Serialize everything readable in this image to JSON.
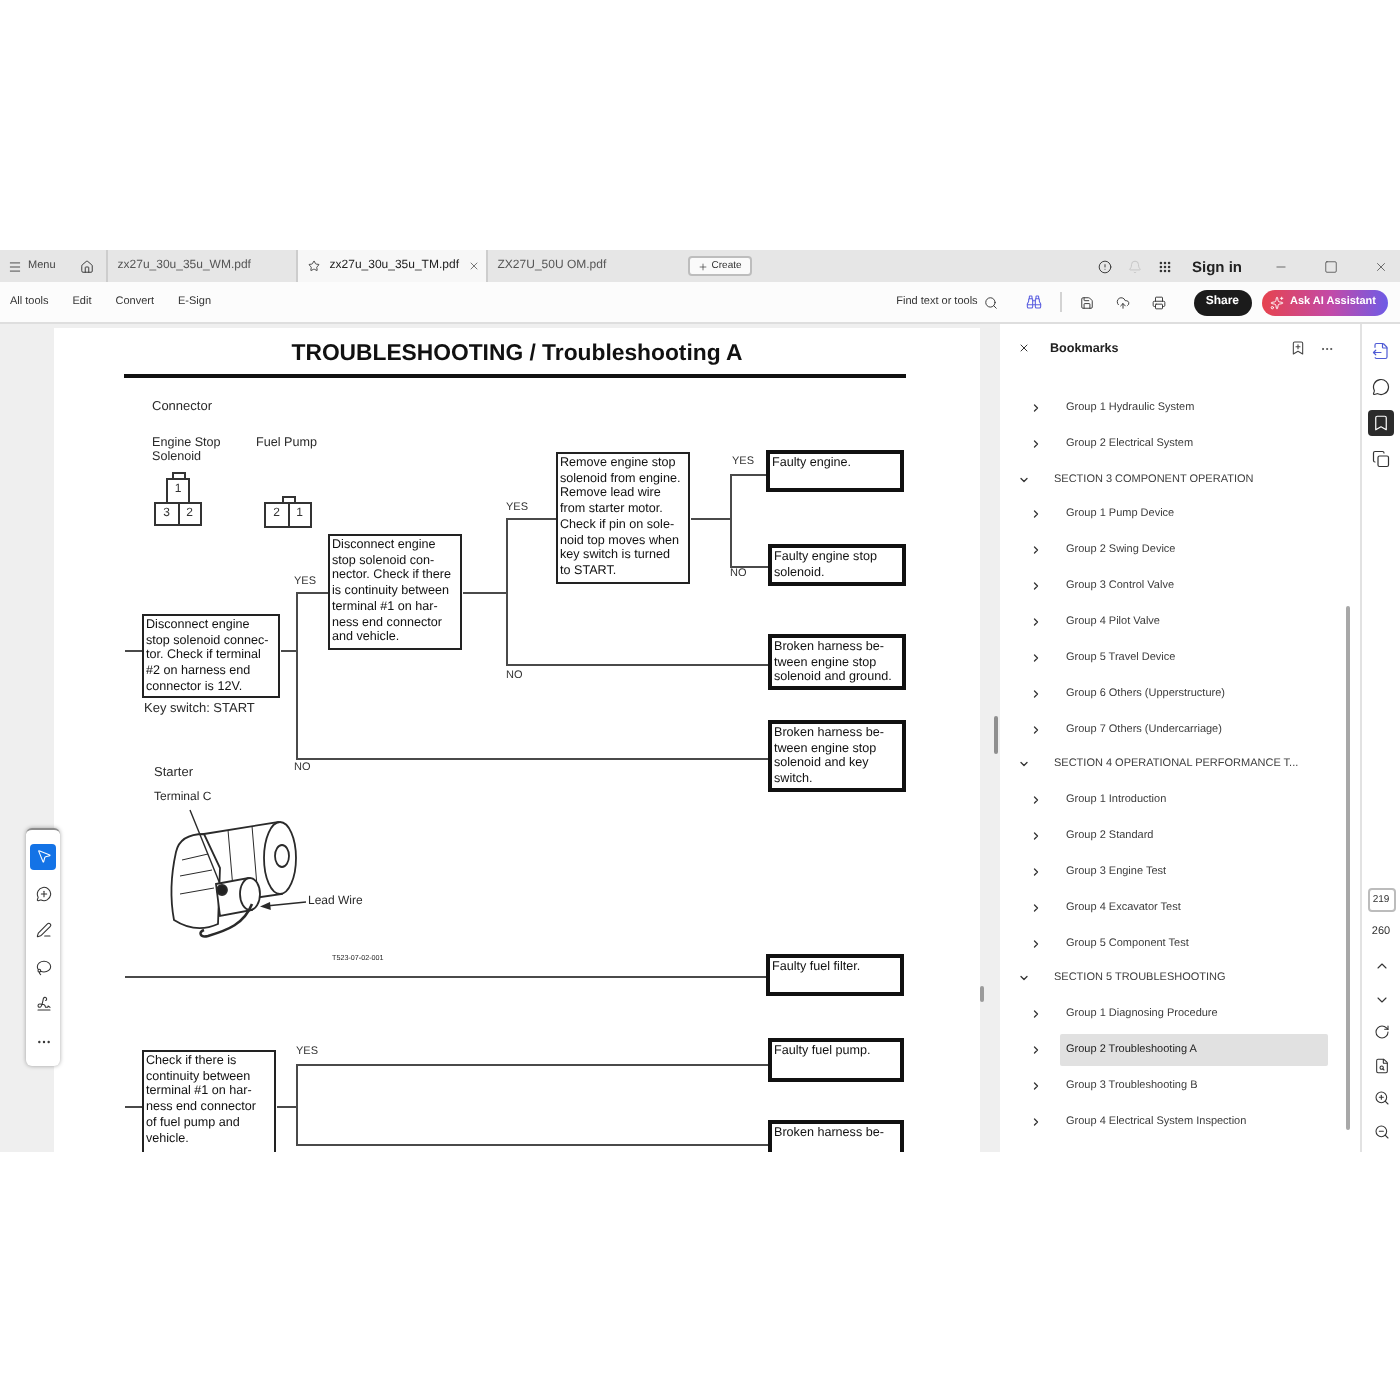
{
  "window": {
    "menu_label": "Menu",
    "tabs": [
      {
        "title": "zx27u_30u_35u_WM.pdf",
        "selected": false
      },
      {
        "title": "zx27u_30u_35u_TM.pdf",
        "selected": true
      },
      {
        "title": "ZX27U_50U OM.pdf",
        "selected": false
      }
    ],
    "create_label": "Create",
    "sign_in_label": "Sign in"
  },
  "toolbar": {
    "items": [
      "All tools",
      "Edit",
      "Convert",
      "E-Sign"
    ],
    "search_label": "Find text or tools",
    "share_label": "Share",
    "assistant_label": "Ask AI Assistant"
  },
  "tool_palette": [
    {
      "kind": "select",
      "selected": true
    },
    {
      "kind": "comment",
      "selected": false
    },
    {
      "kind": "draw",
      "selected": false
    },
    {
      "kind": "shape",
      "selected": false
    },
    {
      "kind": "sign",
      "selected": false
    },
    {
      "kind": "more",
      "selected": false
    }
  ],
  "document": {
    "title": "TROUBLESHOOTING / Troubleshooting A",
    "connector_heading": "Connector",
    "connectors": [
      {
        "label_lines": [
          "Engine Stop",
          "Solenoid"
        ],
        "pin_rows": [
          [
            "1"
          ],
          [
            "3",
            "2"
          ]
        ]
      },
      {
        "label_lines": [
          "Fuel Pump"
        ],
        "pin_rows": [
          [
            "2",
            "1"
          ]
        ]
      }
    ],
    "key_note": "Key switch: START",
    "starter_caption": "Starter",
    "terminal_label": "Terminal C",
    "lead_wire_label": "Lead Wire",
    "figure_code": "T523-07-02-001",
    "steps": [
      {
        "kind": "check",
        "lines": [
          "Disconnect engine",
          "stop solenoid connec-",
          "tor. Check if terminal",
          "#2 on harness end",
          "connector is 12V."
        ]
      },
      {
        "kind": "check",
        "lines": [
          "Disconnect engine",
          "stop solenoid con-",
          "nector. Check if there",
          "is continuity between",
          "terminal #1 on har-",
          "ness end connector",
          "and vehicle."
        ]
      },
      {
        "kind": "check",
        "lines": [
          "Remove engine stop",
          "solenoid from engine.",
          "Remove lead wire",
          "from starter motor.",
          "Check if pin on sole-",
          "noid top moves when",
          "key switch is turned",
          "to START."
        ]
      },
      {
        "kind": "result",
        "lines": [
          "Faulty engine."
        ]
      },
      {
        "kind": "result",
        "lines": [
          "Faulty engine stop",
          "solenoid."
        ]
      },
      {
        "kind": "result",
        "lines": [
          "Broken harness be-",
          "tween engine stop",
          "solenoid and ground."
        ]
      },
      {
        "kind": "result",
        "lines": [
          "Broken harness be-",
          "tween engine stop",
          "solenoid and key",
          "switch."
        ]
      },
      {
        "kind": "result",
        "lines": [
          "Faulty fuel filter."
        ]
      },
      {
        "kind": "check",
        "lines": [
          "Check if there is",
          "continuity between",
          "terminal #1 on har-",
          "ness end connector",
          "of fuel pump and",
          "vehicle."
        ]
      },
      {
        "kind": "result",
        "lines": [
          "Faulty fuel pump."
        ]
      },
      {
        "kind": "result",
        "lines": [
          "Broken harness be-"
        ]
      }
    ],
    "branch_labels": [
      "YES",
      "YES",
      "NO",
      "YES",
      "NO",
      "NO",
      "YES"
    ]
  },
  "bookmarks": {
    "title": "Bookmarks",
    "items": [
      {
        "children": [
          {
            "label": "Group 1 Hydraulic System",
            "expanded": false,
            "selected": false
          },
          {
            "label": "Group 2 Electrical System",
            "expanded": false,
            "selected": false
          }
        ]
      },
      {
        "label": "SECTION 3 COMPONENT OPERATION",
        "expanded": true,
        "selected": false,
        "children": [
          {
            "label": "Group 1 Pump Device",
            "expanded": false,
            "selected": false
          },
          {
            "label": "Group 2 Swing Device",
            "expanded": false,
            "selected": false
          },
          {
            "label": "Group 3 Control Valve",
            "expanded": false,
            "selected": false
          },
          {
            "label": "Group 4 Pilot Valve",
            "expanded": false,
            "selected": false
          },
          {
            "label": "Group 5 Travel Device",
            "expanded": false,
            "selected": false
          },
          {
            "label": "Group 6 Others (Upperstructure)",
            "expanded": false,
            "selected": false
          },
          {
            "label": "Group 7 Others (Undercarriage)",
            "expanded": false,
            "selected": false
          }
        ]
      },
      {
        "label": "SECTION 4 OPERATIONAL PERFORMANCE T...",
        "expanded": true,
        "selected": false,
        "children": [
          {
            "label": "Group 1 Introduction",
            "expanded": false,
            "selected": false
          },
          {
            "label": "Group 2 Standard",
            "expanded": false,
            "selected": false
          },
          {
            "label": "Group 3 Engine Test",
            "expanded": false,
            "selected": false
          },
          {
            "label": "Group 4 Excavator Test",
            "expanded": false,
            "selected": false
          },
          {
            "label": "Group 5 Component Test",
            "expanded": false,
            "selected": false
          }
        ]
      },
      {
        "label": "SECTION 5 TROUBLESHOOTING",
        "expanded": true,
        "selected": false,
        "children": [
          {
            "label": "Group 1 Diagnosing Procedure",
            "expanded": false,
            "selected": false
          },
          {
            "label": "Group 2 Troubleshooting A",
            "expanded": false,
            "selected": true
          },
          {
            "label": "Group 3 Troubleshooting B",
            "expanded": false,
            "selected": false
          },
          {
            "label": "Group 4 Electrical System Inspection",
            "expanded": false,
            "selected": false
          }
        ]
      }
    ]
  },
  "side_rail": [
    {
      "kind": "export",
      "selected": false
    },
    {
      "kind": "comments",
      "selected": false
    },
    {
      "kind": "bookmarks",
      "selected": true
    },
    {
      "kind": "pages",
      "selected": false
    }
  ],
  "page_nav": {
    "current_page": "219",
    "page_count": "260"
  }
}
